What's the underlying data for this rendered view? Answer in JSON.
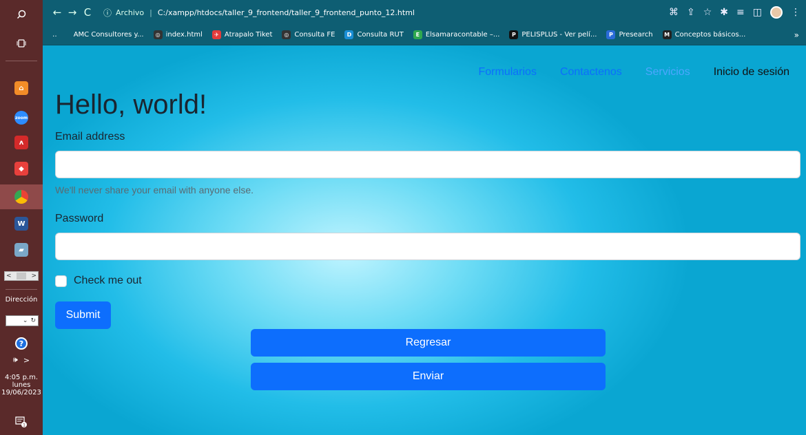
{
  "browser": {
    "url_scheme": "Archivo",
    "url": "C:/xampp/htdocs/taller_9_frontend/taller_9_frontend_punto_12.html",
    "bookmarks": [
      {
        "label": "AMC Consultores y...",
        "icon": "amc-icon",
        "color": "#0e5e73"
      },
      {
        "label": "index.html",
        "icon": "globe-icon",
        "color": "#333333"
      },
      {
        "label": "Atrapalo Tiket",
        "icon": "atrapalo-icon",
        "color": "#e23b3b"
      },
      {
        "label": "Consulta FE",
        "icon": "globe-icon",
        "color": "#333333"
      },
      {
        "label": "Consulta RUT",
        "icon": "dian-icon",
        "color": "#1a8fd6"
      },
      {
        "label": "Elsamaracontable –...",
        "icon": "elsa-icon",
        "color": "#2fa84f"
      },
      {
        "label": "PELISPLUS - Ver pelí...",
        "icon": "pelisplus-icon",
        "color": "#111111"
      },
      {
        "label": "Presearch",
        "icon": "presearch-icon",
        "color": "#2a6bd8"
      },
      {
        "label": "Conceptos básicos...",
        "icon": "conceptos-icon",
        "color": "#222222"
      }
    ],
    "more_bookmarks": "»"
  },
  "taskbar": {
    "direccion_label": "Dirección",
    "time": "4:05 p.m.",
    "day": "lunes",
    "date": "19/06/2023"
  },
  "page": {
    "nav": {
      "formularios": "Formularios",
      "contactenos": "Contactenos",
      "servicios": "Servicios",
      "login": "Inicio de sesión"
    },
    "title": "Hello, world!",
    "email_label": "Email address",
    "email_value": "",
    "email_help": "We'll never share your email with anyone else.",
    "password_label": "Password",
    "password_value": "",
    "checkbox_label": "Check me out",
    "submit_label": "Submit",
    "regresar_label": "Regresar",
    "enviar_label": "Enviar"
  },
  "colors": {
    "primary": "#0d6efd",
    "browser_bar": "#0e5e73",
    "taskbar": "#5a2a2a"
  }
}
